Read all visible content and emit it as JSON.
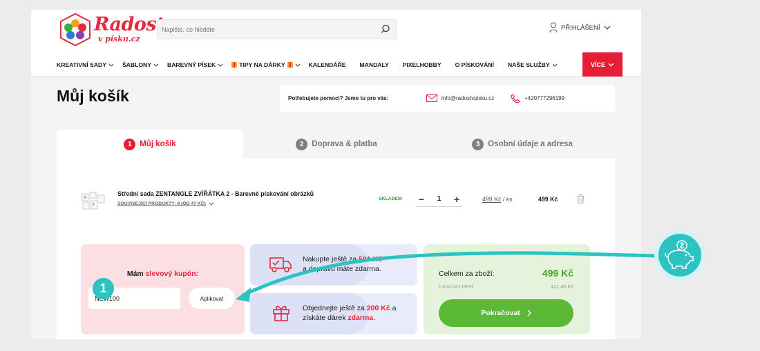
{
  "logo": {
    "text": "Radost",
    "sub": "v písku.cz"
  },
  "search": {
    "placeholder": "Napište, co hledáte"
  },
  "login": {
    "label": "PŘIHLÁŠENÍ"
  },
  "nav": {
    "items": [
      {
        "label": "KREATIVNÍ SADY"
      },
      {
        "label": "ŠABLONY"
      },
      {
        "label": "BAREVNÝ PÍSEK"
      },
      {
        "label": "TIPY NA DÁRKY"
      },
      {
        "label": "KALENDÁŘE"
      },
      {
        "label": "MANDALY"
      },
      {
        "label": "PIXELHOBBY"
      },
      {
        "label": "O PÍSKOVÁNÍ"
      },
      {
        "label": "NAŠE SLUŽBY"
      }
    ],
    "more": "VÍCE"
  },
  "page": {
    "title": "Můj košík"
  },
  "help": {
    "title": "Potřebujete pomoci? Jsme tu pro vás:",
    "email": "info@radostvpisku.cz",
    "phone": "+420777296199"
  },
  "steps": [
    {
      "num": "1",
      "label": "Můj košík"
    },
    {
      "num": "2",
      "label": "Doprava & platba"
    },
    {
      "num": "3",
      "label": "Osobní údaje a adresa"
    }
  ],
  "product": {
    "name": "Střední sada ZENTANGLE ZVÍŘÁTKA 2 - Barevné pískování obrázků",
    "related": "SOUVISEJÍCÍ PRODUKTY: 8 (OD 47 KČ)",
    "stock": "SKLADEM",
    "qty": "1",
    "minus": "−",
    "plus": "+",
    "unit_price": "499 Kč",
    "unit_suffix": "/ ks",
    "total": "499 Kč"
  },
  "coupon": {
    "title_pre": "Mám ",
    "title_em": "slevový kupón:",
    "value": "NEW100",
    "apply": "Aplikovat",
    "badge": "1"
  },
  "shipping": {
    "pre": "Nakupte ještě za ",
    "amount": "591 Kč",
    "post": "a dopravu máte zdarma."
  },
  "gift": {
    "pre": "Objednejte ještě za ",
    "amount": "200 Kč",
    "mid": " a",
    "line2_pre": "získáte dárek ",
    "line2_em": "zdarma",
    "line2_post": "."
  },
  "summary": {
    "label": "Celkem za zboží:",
    "value": "499 Kč",
    "vat_label": "Cena bez DPH:",
    "vat_value": "412,40 Kč",
    "continue": "Pokračovat"
  },
  "colors": {
    "brand_red": "#e51e36",
    "green": "#5cb935",
    "teal": "#2cc3c3"
  }
}
